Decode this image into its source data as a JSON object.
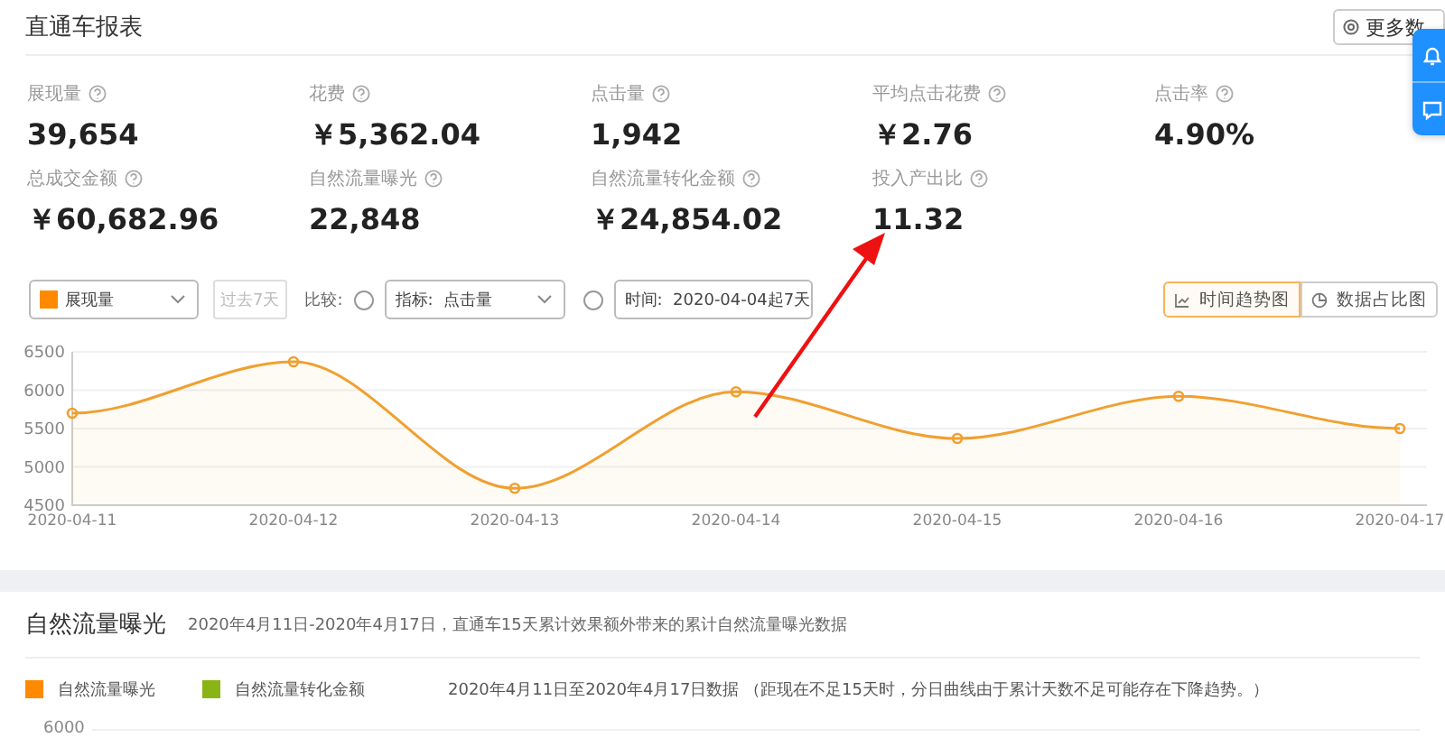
{
  "header": {
    "title": "直通车报表",
    "more_button": "更多数"
  },
  "side_panel": {
    "buttons": [
      {
        "kind": "bell"
      },
      {
        "kind": "chat"
      }
    ]
  },
  "metrics": [
    {
      "label": "展现量",
      "value": "39,654"
    },
    {
      "label": "花费",
      "value": "￥5,362.04"
    },
    {
      "label": "点击量",
      "value": "1,942"
    },
    {
      "label": "平均点击花费",
      "value": "￥2.76"
    },
    {
      "label": "点击率",
      "value": "4.90%"
    },
    {
      "label": "总成交金额",
      "value": "￥60,682.96"
    },
    {
      "label": "自然流量曝光",
      "value": "22,848"
    },
    {
      "label": "自然流量转化金额",
      "value": "￥24,854.02"
    },
    {
      "label": "投入产出比",
      "value": "11.32"
    }
  ],
  "toolbar": {
    "metric_select": {
      "value": "展现量"
    },
    "period_button": {
      "label": "过去7天",
      "disabled": true
    },
    "compare_label": "比较:",
    "compare_options": [
      {
        "kind": "select",
        "value": "指标:  点击量",
        "selected": false
      },
      {
        "kind": "select",
        "value": "时间:  2020-04-04起7天",
        "selected": false
      }
    ],
    "view_tabs": [
      {
        "label": "时间趋势图",
        "kind": "line",
        "selected": true
      },
      {
        "label": "数据占比图",
        "kind": "pie",
        "selected": false
      }
    ]
  },
  "trend_chart": {
    "chart_data": {
      "type": "area",
      "categories": [
        "2020-04-11",
        "2020-04-12",
        "2020-04-13",
        "2020-04-14",
        "2020-04-15",
        "2020-04-16",
        "2020-04-17"
      ],
      "series": [
        {
          "color": "#f0a030",
          "values": [
            5700,
            6370,
            4720,
            5980,
            5370,
            5920,
            5500
          ]
        }
      ],
      "ylim": [
        4500,
        6500
      ],
      "yticks": [
        4500,
        5000,
        5500,
        6000,
        6500
      ],
      "grid": true
    }
  },
  "natural_section": {
    "title": "自然流量曝光",
    "description": "2020年4月11日-2020年4月17日，直通车15天累计效果额外带来的累计自然流量曝光数据",
    "legend": [
      {
        "label": "自然流量曝光",
        "color": "#ff8a00"
      },
      {
        "label": "自然流量转化金额",
        "color": "#8ab416"
      }
    ],
    "note": "2020年4月11日至2020年4月17日数据 （距现在不足15天时，分日曲线由于累计天数不足可能存在下降趋势。）",
    "chart_top_tick": "6000"
  }
}
